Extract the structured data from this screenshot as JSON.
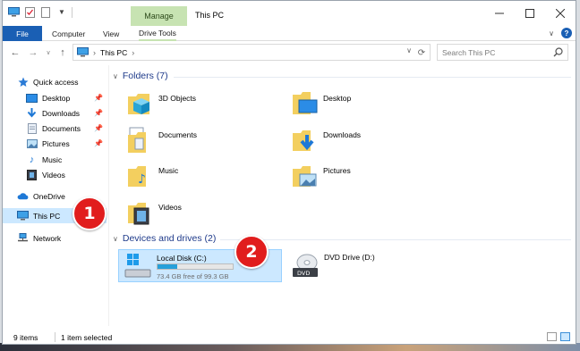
{
  "window": {
    "title": "This PC",
    "manage_tab": "Manage",
    "controls": {
      "minimize": "minimize-icon",
      "maximize": "maximize-icon",
      "close": "close-icon"
    }
  },
  "ribbon": {
    "tabs": [
      "File",
      "Computer",
      "View",
      "Drive Tools"
    ]
  },
  "nav": {
    "address": "This PC",
    "search_placeholder": "Search This PC"
  },
  "sidebar": {
    "items": [
      {
        "label": "Quick access",
        "icon": "star-icon"
      },
      {
        "label": "Desktop",
        "icon": "desktop-icon",
        "pinned": true
      },
      {
        "label": "Downloads",
        "icon": "download-icon",
        "pinned": true
      },
      {
        "label": "Documents",
        "icon": "document-icon",
        "pinned": true
      },
      {
        "label": "Pictures",
        "icon": "picture-icon",
        "pinned": true
      },
      {
        "label": "Music",
        "icon": "music-icon"
      },
      {
        "label": "Videos",
        "icon": "video-icon"
      },
      {
        "label": "OneDrive",
        "icon": "cloud-icon"
      },
      {
        "label": "This PC",
        "icon": "computer-icon",
        "selected": true
      },
      {
        "label": "Network",
        "icon": "network-icon"
      }
    ]
  },
  "content": {
    "folders_header": "Folders (7)",
    "folders": [
      "3D Objects",
      "Desktop",
      "Documents",
      "Downloads",
      "Music",
      "Pictures",
      "Videos"
    ],
    "drives_header": "Devices and drives (2)",
    "drives": [
      {
        "name": "Local Disk (C:)",
        "free_text": "73.4 GB free of 99.3 GB",
        "used_fraction": 0.26
      },
      {
        "name": "DVD Drive (D:)"
      }
    ]
  },
  "status": {
    "item_count": "9 items",
    "selection": "1 item selected"
  },
  "badges": [
    "1",
    "2"
  ],
  "colors": {
    "accent": "#1a5fb4",
    "selection": "#cce8ff",
    "manage_tab": "#c7e3b2",
    "badge": "#e11d1d",
    "progress": "#26a0da"
  }
}
